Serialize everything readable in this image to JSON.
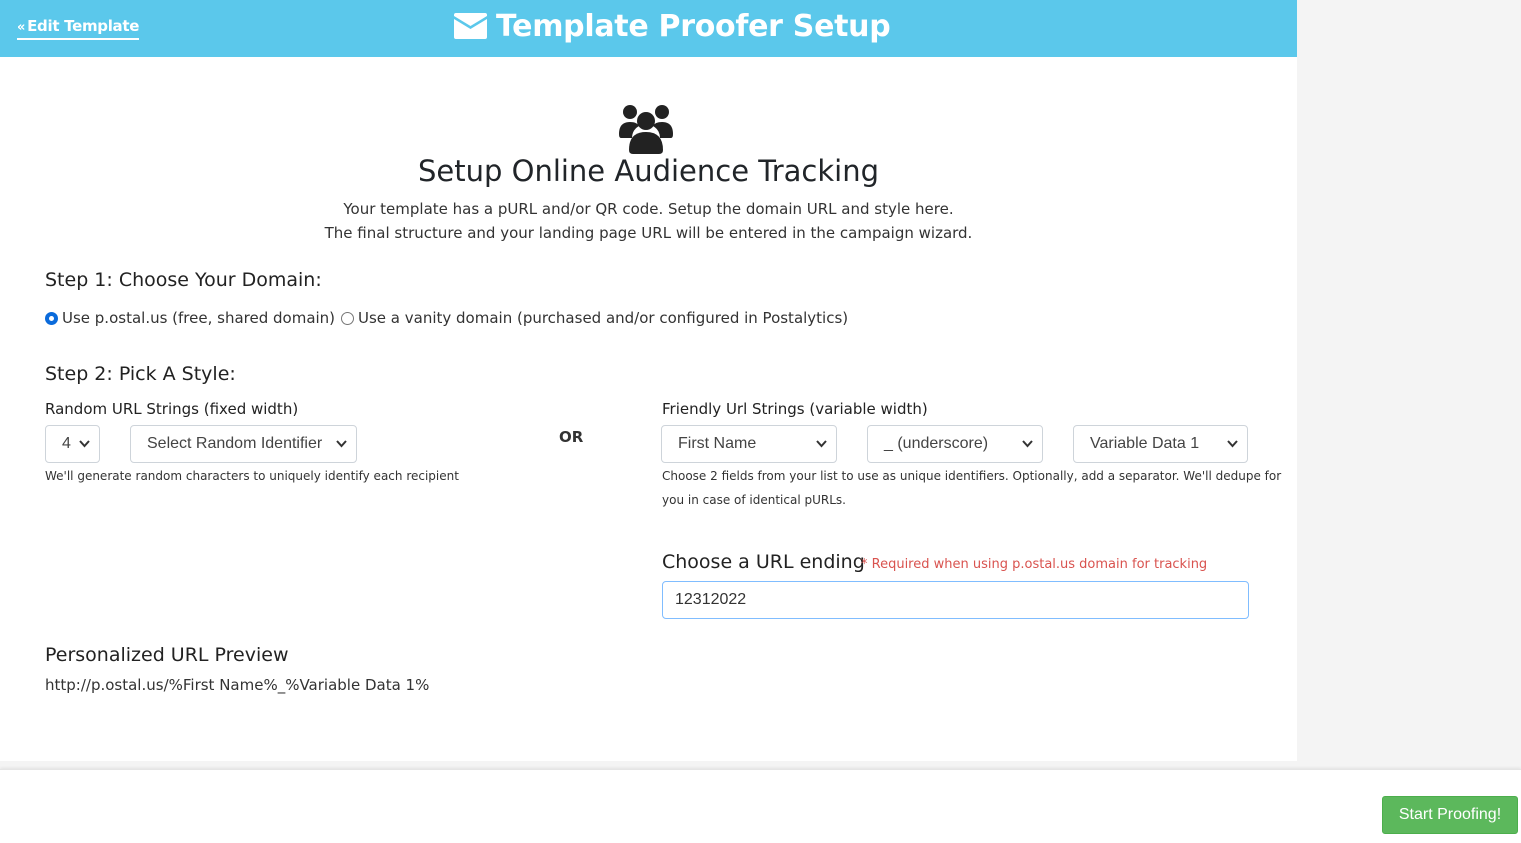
{
  "header": {
    "back_label": "Edit Template",
    "title": "Template Proofer Setup",
    "title_icon": "envelope-icon",
    "color": "#5bc8eb"
  },
  "intro": {
    "icon": "users-icon",
    "heading": "Setup Online Audience Tracking",
    "line1": "Your template has a pURL and/or QR code. Setup the domain URL and style here.",
    "line2": "The final structure and your landing page URL will be entered in the campaign wizard."
  },
  "step1": {
    "heading": "Step 1: Choose Your Domain:",
    "options": [
      {
        "label": "Use p.ostal.us (free, shared domain)",
        "checked": true
      },
      {
        "label": "Use a vanity domain (purchased and/or configured in Postalytics)",
        "checked": false
      }
    ]
  },
  "step2": {
    "heading": "Step 2: Pick A Style:",
    "random": {
      "label": "Random URL Strings (fixed width)",
      "length_value": "4",
      "identifier_value": "Select Random Identifier",
      "help": "We'll generate random characters to uniquely identify each recipient"
    },
    "or_label": "OR",
    "friendly": {
      "label": "Friendly Url Strings (variable width)",
      "field1_value": "First Name",
      "separator_value": "_ (underscore)",
      "field2_value": "Variable Data 1",
      "help_line1": "Choose 2 fields from your list to use as unique identifiers. Optionally, add a separator. We'll dedupe for",
      "help_line2": "you in case of identical pURLs."
    }
  },
  "url_ending": {
    "title": "Choose a URL ending",
    "required_note": "* Required when using p.ostal.us domain for tracking",
    "value": "12312022"
  },
  "preview": {
    "title": "Personalized URL Preview",
    "url": "http://p.ostal.us/%First Name%_%Variable Data 1%"
  },
  "footer": {
    "start_label": "Start Proofing!",
    "button_color": "#5cb85c"
  }
}
